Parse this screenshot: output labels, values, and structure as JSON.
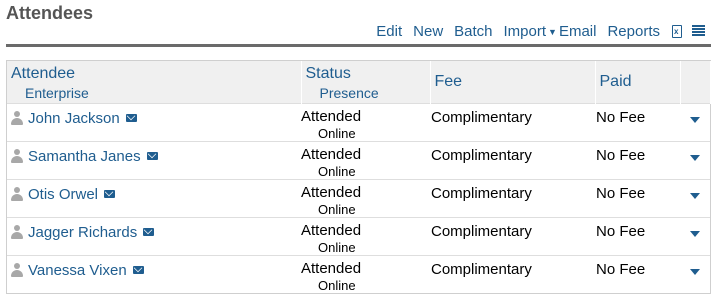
{
  "page": {
    "title": "Attendees"
  },
  "toolbar": {
    "edit": "Edit",
    "new": "New",
    "batch": "Batch",
    "import": "Import",
    "email": "Email",
    "reports": "Reports",
    "excel_icon_label": "x",
    "icons": {
      "export": "excel-icon",
      "menu": "list-icon"
    }
  },
  "table": {
    "headers": {
      "attendee": "Attendee",
      "enterprise": "Enterprise",
      "status": "Status",
      "presence": "Presence",
      "fee": "Fee",
      "paid": "Paid"
    },
    "rows": [
      {
        "name": "John Jackson",
        "status": "Attended",
        "presence": "Online",
        "fee": "Complimentary",
        "paid": "No Fee"
      },
      {
        "name": "Samantha Janes",
        "status": "Attended",
        "presence": "Online",
        "fee": "Complimentary",
        "paid": "No Fee"
      },
      {
        "name": "Otis Orwel",
        "status": "Attended",
        "presence": "Online",
        "fee": "Complimentary",
        "paid": "No Fee"
      },
      {
        "name": "Jagger Richards",
        "status": "Attended",
        "presence": "Online",
        "fee": "Complimentary",
        "paid": "No Fee"
      },
      {
        "name": "Vanessa Vixen",
        "status": "Attended",
        "presence": "Online",
        "fee": "Complimentary",
        "paid": "No Fee"
      }
    ]
  },
  "colors": {
    "link": "#1f5d8f",
    "header_bg": "#f0f0f0",
    "title": "#555555",
    "icon_gray": "#a8a8a8"
  }
}
